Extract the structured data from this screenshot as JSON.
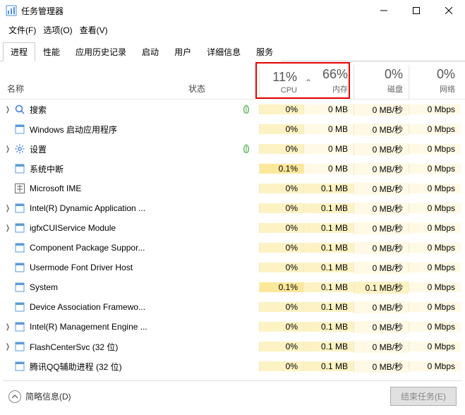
{
  "window": {
    "title": "任务管理器",
    "minimize": "–",
    "maximize": "☐",
    "close": "✕"
  },
  "menu": {
    "file": "文件(F)",
    "options": "选项(O)",
    "view": "查看(V)"
  },
  "tabs": [
    "进程",
    "性能",
    "应用历史记录",
    "启动",
    "用户",
    "详细信息",
    "服务"
  ],
  "active_tab": 0,
  "columns": {
    "name": "名称",
    "status": "状态",
    "metrics": [
      {
        "pct": "11%",
        "label": "CPU"
      },
      {
        "pct": "66%",
        "label": "内存"
      },
      {
        "pct": "0%",
        "label": "磁盘"
      },
      {
        "pct": "0%",
        "label": "网络"
      }
    ],
    "sort_indicator": "⌃"
  },
  "processes": [
    {
      "exp": true,
      "icon": "search",
      "name": "搜索",
      "leaf": true,
      "cpu": "0%",
      "cpu_h": 1,
      "mem": "0 MB",
      "mem_h": 0,
      "disk": "0 MB/秒",
      "disk_h": 0,
      "net": "0 Mbps",
      "net_h": 0
    },
    {
      "exp": false,
      "icon": "app",
      "name": "Windows 启动应用程序",
      "leaf": false,
      "cpu": "0%",
      "cpu_h": 1,
      "mem": "0 MB",
      "mem_h": 0,
      "disk": "0 MB/秒",
      "disk_h": 0,
      "net": "0 Mbps",
      "net_h": 0
    },
    {
      "exp": true,
      "icon": "settings",
      "name": "设置",
      "leaf": true,
      "cpu": "0%",
      "cpu_h": 1,
      "mem": "0 MB",
      "mem_h": 0,
      "disk": "0 MB/秒",
      "disk_h": 0,
      "net": "0 Mbps",
      "net_h": 0
    },
    {
      "exp": false,
      "icon": "app",
      "name": "系统中断",
      "leaf": false,
      "cpu": "0.1%",
      "cpu_h": 2,
      "mem": "0 MB",
      "mem_h": 0,
      "disk": "0 MB/秒",
      "disk_h": 0,
      "net": "0 Mbps",
      "net_h": 0
    },
    {
      "exp": false,
      "icon": "ime",
      "name": "Microsoft IME",
      "leaf": false,
      "cpu": "0%",
      "cpu_h": 1,
      "mem": "0.1 MB",
      "mem_h": 1,
      "disk": "0 MB/秒",
      "disk_h": 0,
      "net": "0 Mbps",
      "net_h": 0
    },
    {
      "exp": true,
      "icon": "app",
      "name": "Intel(R) Dynamic Application ...",
      "leaf": false,
      "cpu": "0%",
      "cpu_h": 1,
      "mem": "0.1 MB",
      "mem_h": 1,
      "disk": "0 MB/秒",
      "disk_h": 0,
      "net": "0 Mbps",
      "net_h": 0
    },
    {
      "exp": true,
      "icon": "app",
      "name": "igfxCUIService Module",
      "leaf": false,
      "cpu": "0%",
      "cpu_h": 1,
      "mem": "0.1 MB",
      "mem_h": 1,
      "disk": "0 MB/秒",
      "disk_h": 0,
      "net": "0 Mbps",
      "net_h": 0
    },
    {
      "exp": false,
      "icon": "app",
      "name": "Component Package Suppor...",
      "leaf": false,
      "cpu": "0%",
      "cpu_h": 1,
      "mem": "0.1 MB",
      "mem_h": 1,
      "disk": "0 MB/秒",
      "disk_h": 0,
      "net": "0 Mbps",
      "net_h": 0
    },
    {
      "exp": false,
      "icon": "app",
      "name": "Usermode Font Driver Host",
      "leaf": false,
      "cpu": "0%",
      "cpu_h": 1,
      "mem": "0.1 MB",
      "mem_h": 1,
      "disk": "0 MB/秒",
      "disk_h": 0,
      "net": "0 Mbps",
      "net_h": 0
    },
    {
      "exp": false,
      "icon": "app",
      "name": "System",
      "leaf": false,
      "cpu": "0.1%",
      "cpu_h": 2,
      "mem": "0.1 MB",
      "mem_h": 1,
      "disk": "0.1 MB/秒",
      "disk_h": 1,
      "net": "0 Mbps",
      "net_h": 0
    },
    {
      "exp": false,
      "icon": "app",
      "name": "Device Association Framewo...",
      "leaf": false,
      "cpu": "0%",
      "cpu_h": 1,
      "mem": "0.1 MB",
      "mem_h": 1,
      "disk": "0 MB/秒",
      "disk_h": 0,
      "net": "0 Mbps",
      "net_h": 0
    },
    {
      "exp": true,
      "icon": "app",
      "name": "Intel(R) Management Engine ...",
      "leaf": false,
      "cpu": "0%",
      "cpu_h": 1,
      "mem": "0.1 MB",
      "mem_h": 1,
      "disk": "0 MB/秒",
      "disk_h": 0,
      "net": "0 Mbps",
      "net_h": 0
    },
    {
      "exp": true,
      "icon": "app",
      "name": "FlashCenterSvc (32 位)",
      "leaf": false,
      "cpu": "0%",
      "cpu_h": 1,
      "mem": "0.1 MB",
      "mem_h": 1,
      "disk": "0 MB/秒",
      "disk_h": 0,
      "net": "0 Mbps",
      "net_h": 0
    },
    {
      "exp": false,
      "icon": "app",
      "name": "腾讯QQ辅助进程 (32 位)",
      "leaf": false,
      "cpu": "0%",
      "cpu_h": 1,
      "mem": "0.1 MB",
      "mem_h": 1,
      "disk": "0 MB/秒",
      "disk_h": 0,
      "net": "0 Mbps",
      "net_h": 0
    }
  ],
  "footer": {
    "brief": "简略信息(D)",
    "end_task": "结束任务(E)"
  }
}
